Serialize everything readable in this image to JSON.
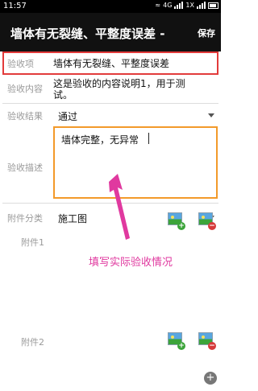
{
  "status_bar": {
    "time": "11:57",
    "net1": "4G",
    "net2": "1X"
  },
  "app_bar": {
    "title": "墙体有无裂缝、平整度误差 -",
    "save_label": "保存"
  },
  "form": {
    "item": {
      "label": "验收项",
      "value": "墙体有无裂缝、平整度误差"
    },
    "content": {
      "label": "验收内容",
      "value_line1": "这是验收的内容说明1，用于测",
      "value_line2": "试。"
    },
    "result": {
      "label": "验收结果",
      "value": "通过"
    },
    "description": {
      "label": "验收描述",
      "value": "墙体完整，无异常"
    },
    "category": {
      "label": "附件分类",
      "value": "施工图"
    },
    "attachment1": {
      "label": "附件1"
    },
    "attachment2": {
      "label": "附件2"
    }
  },
  "annotation": {
    "text": "填写实际验收情况",
    "color": "#e0399f"
  },
  "colors": {
    "highlight_red": "#e23b3b",
    "focus_orange": "#f39a2a"
  }
}
